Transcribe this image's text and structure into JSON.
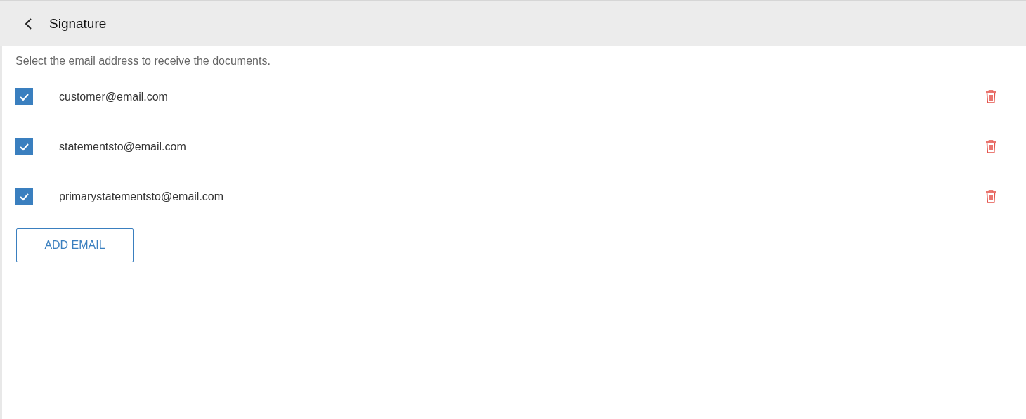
{
  "header": {
    "title": "Signature"
  },
  "instruction": "Select the email address to receive the documents.",
  "emails": [
    {
      "address": "customer@email.com",
      "checked": true
    },
    {
      "address": "statementsto@email.com",
      "checked": true
    },
    {
      "address": "primarystatementsto@email.com",
      "checked": true
    }
  ],
  "add_button": "ADD EMAIL"
}
